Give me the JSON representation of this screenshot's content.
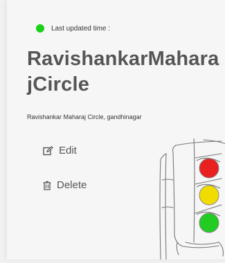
{
  "status": {
    "label": "Last updated time :",
    "indicator_color": "#1ad11a"
  },
  "location": {
    "name": "RavishankarMaharajCircle",
    "address": "Ravishankar Maharaj Circle, gandhinagar"
  },
  "actions": {
    "edit_label": "Edit",
    "delete_label": "Delete"
  },
  "colors": {
    "title": "#555555",
    "signal_red": "#e82020",
    "signal_yellow": "#f2dc00",
    "signal_green": "#22cc22"
  }
}
